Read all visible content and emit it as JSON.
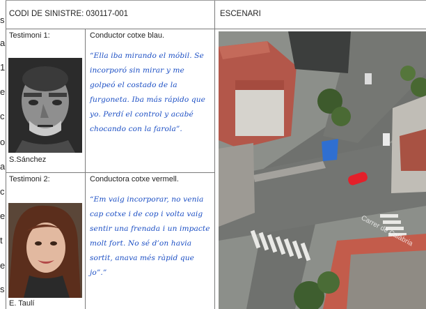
{
  "edge_fragments": [
    "s",
    "a",
    "1",
    "e",
    "c",
    "o",
    "a",
    "c",
    "e",
    "t",
    "e",
    "s"
  ],
  "header": {
    "case_code": "CODI DE SINISTRE: 030117-001",
    "scene_title": "ESCENARI"
  },
  "witnesses": [
    {
      "label": "Testimoni 1:",
      "role": "Conductor cotxe blau.",
      "statement": "“Ella iba mirando el móbil. Se incorporó sin mirar y me golpeó el costado de la furgoneta. Iba más rápido que yo. Perdí el control y acabé chocando con la farola”.",
      "name": "S.Sánchez"
    },
    {
      "label": "Testimoni 2:",
      "role": "Conductora cotxe vermell.",
      "statement": "“Em vaig incorporar, no venia cap cotxe i de cop i volta vaig sentir una frenada i un impacte molt fort. No sé d’on havia sortit, anava més ràpid que jo”.”",
      "name": "E. Taulí"
    }
  ],
  "map": {
    "watermark": "Carrer de Calàbria",
    "colors": {
      "blue_car": "#2f6fd1",
      "red_car": "#e3202a"
    }
  }
}
